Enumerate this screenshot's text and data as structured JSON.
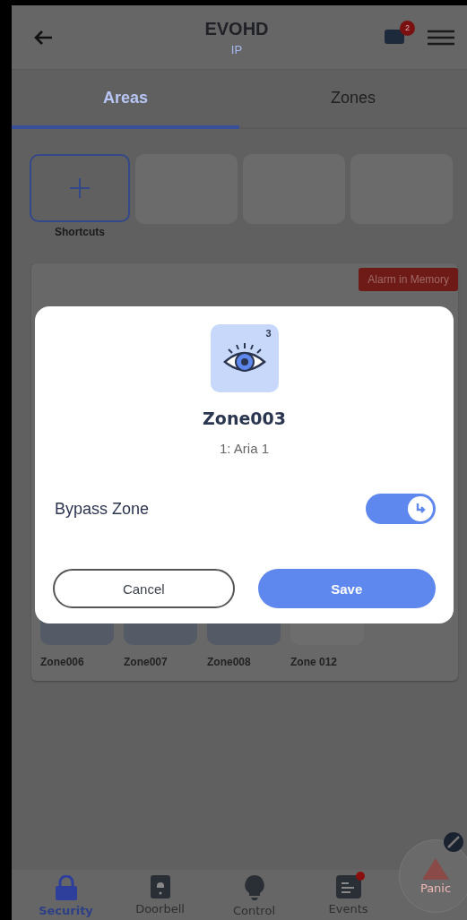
{
  "header": {
    "title": "EVOHD",
    "subtitle": "IP",
    "notification_badge": "2"
  },
  "tabs": [
    {
      "label": "Areas",
      "selected": true
    },
    {
      "label": "Zones",
      "selected": false
    }
  ],
  "shortcuts": [
    {
      "kind": "add",
      "label": "Shortcuts"
    },
    {
      "kind": "empty"
    },
    {
      "kind": "empty"
    },
    {
      "kind": "empty"
    }
  ],
  "area_card": {
    "tag": "Alarm in Memory",
    "zones": [
      {
        "name": "Zone006",
        "active": true
      },
      {
        "name": "Zone007",
        "active": true
      },
      {
        "name": "Zone008",
        "active": true
      },
      {
        "name": "Zone 012",
        "active": false
      }
    ]
  },
  "dialog": {
    "zone_number": "3",
    "title": "Zone003",
    "subtitle": "1: Aria 1",
    "bypass": {
      "label": "Bypass Zone",
      "on": true
    },
    "buttons": [
      {
        "label": "Cancel",
        "kind": "secondary"
      },
      {
        "label": "Save",
        "kind": "primary"
      }
    ]
  },
  "bottom_nav": [
    {
      "label": "Security",
      "kind": "lock",
      "selected": true,
      "alert": false
    },
    {
      "label": "Doorbell",
      "kind": "doorbell",
      "selected": false,
      "alert": false
    },
    {
      "label": "Control",
      "kind": "bulb",
      "selected": false,
      "alert": false
    },
    {
      "label": "Events",
      "kind": "events",
      "selected": false,
      "alert": true
    }
  ],
  "panic": {
    "label": "Panic"
  }
}
